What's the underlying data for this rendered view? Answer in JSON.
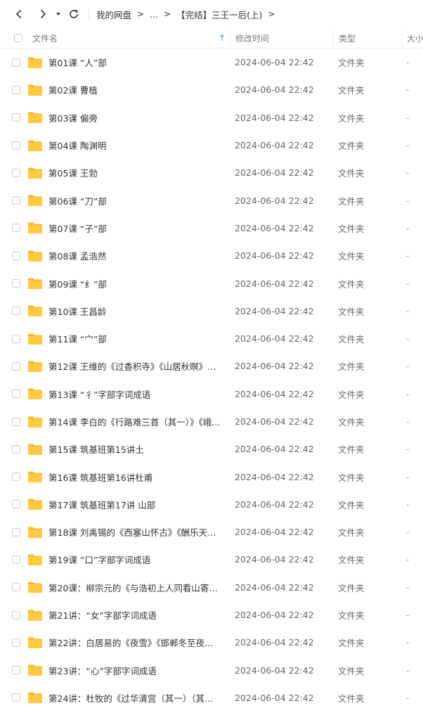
{
  "toolbar": {
    "back_icon": "chevron-left-icon",
    "forward_icon": "chevron-right-icon",
    "dropdown_icon": "caret-down-icon",
    "refresh_icon": "refresh-icon",
    "breadcrumb": [
      "我的网盘",
      "...",
      "【完结】三王一后(上)"
    ]
  },
  "columns": {
    "name": "文件名",
    "time": "修改时间",
    "type": "类型",
    "size": "大小"
  },
  "colors": {
    "accent": "#3a8cff",
    "folder": "#ffc940"
  },
  "files": [
    {
      "name": "第01课 “人”部",
      "time": "2024-06-04 22:42",
      "type": "文件夹",
      "size": "-"
    },
    {
      "name": "第02课 曹植",
      "time": "2024-06-04 22:42",
      "type": "文件夹",
      "size": "-"
    },
    {
      "name": "第03课 偏旁",
      "time": "2024-06-04 22:42",
      "type": "文件夹",
      "size": "-"
    },
    {
      "name": "第04课 陶渊明",
      "time": "2024-06-04 22:42",
      "type": "文件夹",
      "size": "-"
    },
    {
      "name": "第05课 王勃",
      "time": "2024-06-04 22:42",
      "type": "文件夹",
      "size": "-"
    },
    {
      "name": "第06课 “刀”部",
      "time": "2024-06-04 22:42",
      "type": "文件夹",
      "size": "-"
    },
    {
      "name": "第07课 “子”部",
      "time": "2024-06-04 22:42",
      "type": "文件夹",
      "size": "-"
    },
    {
      "name": "第08课 孟浩然",
      "time": "2024-06-04 22:42",
      "type": "文件夹",
      "size": "-"
    },
    {
      "name": "第09课 “纟”部",
      "time": "2024-06-04 22:42",
      "type": "文件夹",
      "size": "-"
    },
    {
      "name": "第10课 王昌龄",
      "time": "2024-06-04 22:42",
      "type": "文件夹",
      "size": "-"
    },
    {
      "name": "第11课 “宀”部",
      "time": "2024-06-04 22:42",
      "type": "文件夹",
      "size": "-"
    },
    {
      "name": "第12课 王维的《过香积寺》《山居秋暝》等...",
      "time": "2024-06-04 22:42",
      "type": "文件夹",
      "size": "-"
    },
    {
      "name": "第13课 “彳”字部字词成语",
      "time": "2024-06-04 22:42",
      "type": "文件夹",
      "size": "-"
    },
    {
      "name": "第14课 李白的《行路难三首（其一）》《峨...",
      "time": "2024-06-04 22:42",
      "type": "文件夹",
      "size": "-"
    },
    {
      "name": "第15课 筑基班第15讲土",
      "time": "2024-06-04 22:42",
      "type": "文件夹",
      "size": "-"
    },
    {
      "name": "第16课 筑基班第16讲杜甫",
      "time": "2024-06-04 22:42",
      "type": "文件夹",
      "size": "-"
    },
    {
      "name": "第17课  筑基班第17讲 山部",
      "time": "2024-06-04 22:42",
      "type": "文件夹",
      "size": "-"
    },
    {
      "name": "第18课 刘禹锡的《西塞山怀古》《酬乐天扬...",
      "time": "2024-06-04 22:42",
      "type": "文件夹",
      "size": "-"
    },
    {
      "name": "第19课 “口”字部字词成语",
      "time": "2024-06-04 22:42",
      "type": "文件夹",
      "size": "-"
    },
    {
      "name": "第20课：柳宗元的《与浩初上人同看山寄京华...",
      "time": "2024-06-04 22:42",
      "type": "文件夹",
      "size": "-"
    },
    {
      "name": "第21讲：“女”字部字词成语",
      "time": "2024-06-04 22:42",
      "type": "文件夹",
      "size": "-"
    },
    {
      "name": "第22讲：白居易的《夜雪》《邯郸冬至夜思家...",
      "time": "2024-06-04 22:42",
      "type": "文件夹",
      "size": "-"
    },
    {
      "name": "第23讲：“心”字部字词成语",
      "time": "2024-06-04 22:42",
      "type": "文件夹",
      "size": "-"
    },
    {
      "name": "第24讲：杜牧的《过华清宫（其一）（其二）...",
      "time": "2024-06-04 22:42",
      "type": "文件夹",
      "size": "-"
    }
  ]
}
